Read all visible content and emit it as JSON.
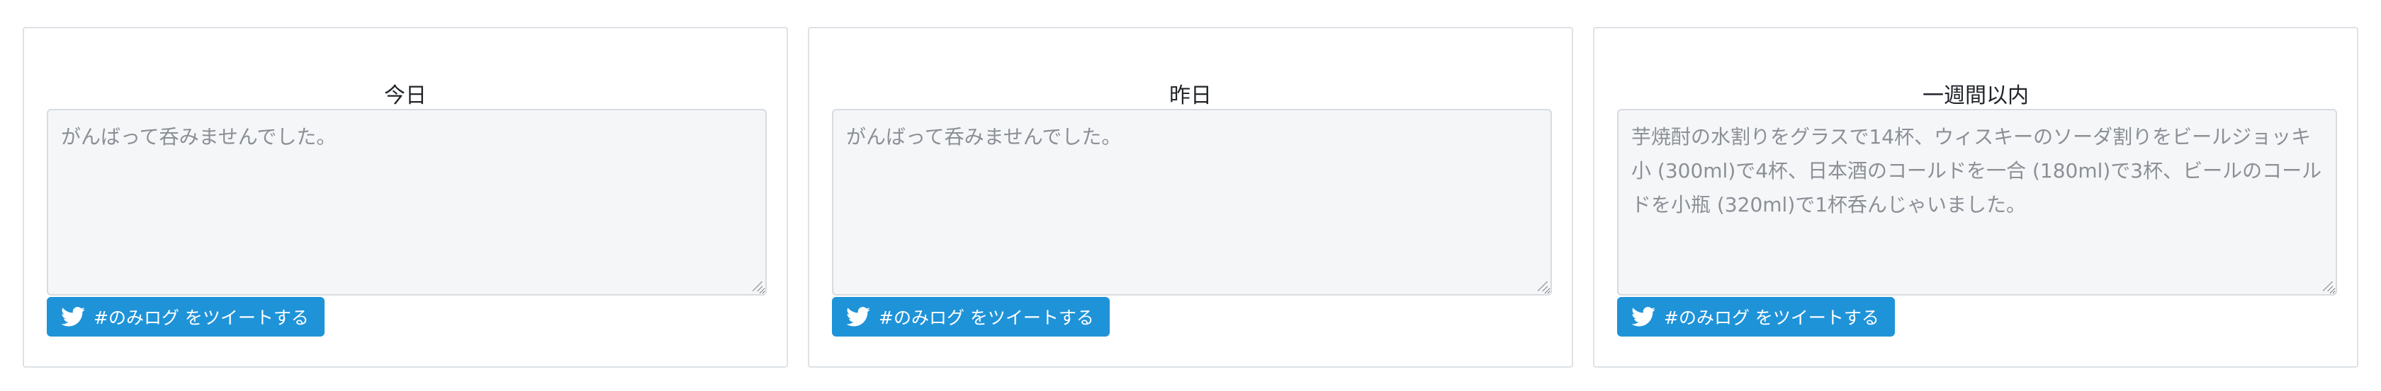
{
  "cards": [
    {
      "title": "今日",
      "placeholder": "がんばって呑みませんでした。",
      "text": "",
      "button_label": "#のみログ をツイートする",
      "button_icon": "twitter-bird-icon"
    },
    {
      "title": "昨日",
      "placeholder": "がんばって呑みませんでした。",
      "text": "",
      "button_label": "#のみログ をツイートする",
      "button_icon": "twitter-bird-icon"
    },
    {
      "title": "一週間以内",
      "placeholder": "",
      "text": "芋焼酎の水割りをグラスで14杯、ウィスキーのソーダ割りをビールジョッキ 小 (300ml)で4杯、日本酒のコールドを一合 (180ml)で3杯、ビールのコールドを小瓶 (320ml)で1杯呑んじゃいました。",
      "button_label": "#のみログ をツイートする",
      "button_icon": "twitter-bird-icon"
    }
  ],
  "colors": {
    "button_bg": "#1f93d8",
    "card_border": "#dee2e6",
    "textarea_bg": "#f5f6f8",
    "text_muted": "#8b9096"
  }
}
